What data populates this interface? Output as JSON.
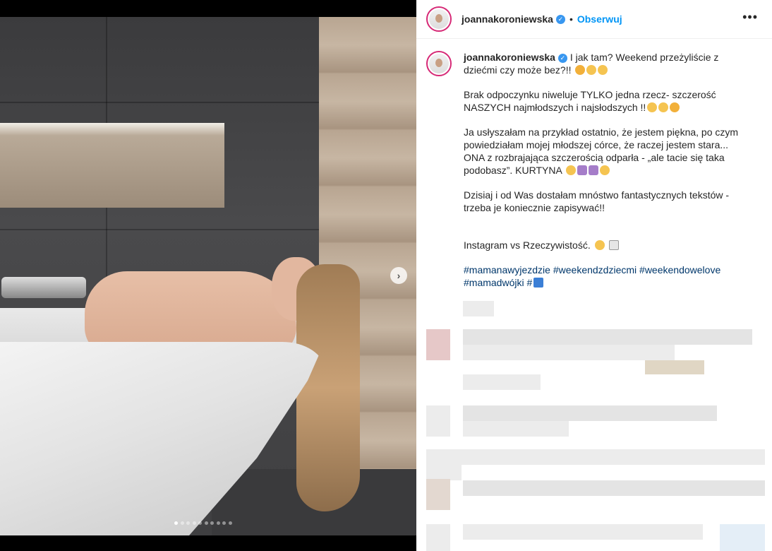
{
  "post": {
    "username": "joannakoroniewska",
    "follow_label": "Obserwuj",
    "separator": "•",
    "more_label": "•••",
    "verified_mark": "✓"
  },
  "caption": {
    "username": "joannakoroniewska",
    "p1_text": " I jak tam? Weekend przeżyliście z dziećmi czy może bez?!! ",
    "p2_text": "Brak odpoczynku niweluje TYLKO jedna rzecz- szczerość NASZYCH najmłodszych i najsłodszych !!",
    "p3_text": "Ja usłyszałam na przykład ostatnio, że jestem piękna, po czym powiedziałam mojej młodszej córce, że raczej jestem stara... ONA z rozbrajająca szczerością odparła - „ale tacie się taka podobasz”. KURTYNA ",
    "p4_text": "Dzisiaj i od Was dostałam mnóstwo fantastycznych tekstów - trzeba je koniecznie zapisywać!!",
    "p5_text": "Instagram vs Rzeczywistość. ",
    "hashtags": [
      "#mamanawyjezdzie",
      "#weekendzdziecmi",
      "#weekendowelove",
      "#mamadwójki",
      "#"
    ]
  },
  "media": {
    "next_arrow": "›",
    "carousel_count": 10,
    "carousel_active": 0
  },
  "colors": {
    "follow": "#0095f6",
    "hashtag": "#00376b",
    "verified": "#3897f0",
    "avatar_ring": "#d62976"
  }
}
